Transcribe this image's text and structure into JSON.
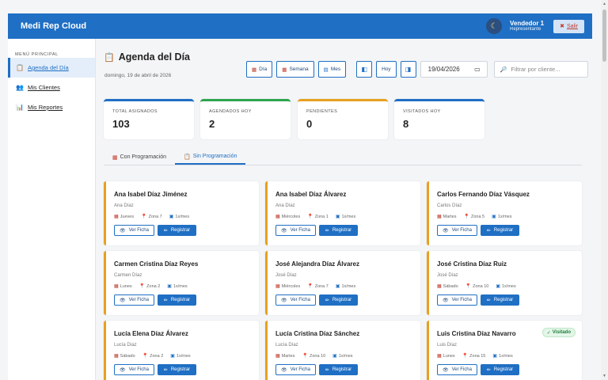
{
  "app": {
    "brand": "Medi Rep Cloud",
    "theme_icon": "moon-icon",
    "user_name": "Vendedor 1",
    "user_role": "Representante",
    "logout_label": "Salir"
  },
  "sidebar": {
    "title": "MENÚ PRINCIPAL",
    "items": [
      {
        "label": "Agenda del Día",
        "icon": "clipboard-icon"
      },
      {
        "label": "Mis Clientes",
        "icon": "users-icon"
      },
      {
        "label": "Mis Reportes",
        "icon": "chart-icon"
      }
    ]
  },
  "header": {
    "title": "Agenda del Día",
    "date_text": "domingo, 19 de abril de 2026"
  },
  "toolbar": {
    "day": "Día",
    "week": "Semana",
    "month": "Mes",
    "today": "Hoy",
    "prev_icon": "prev-icon",
    "next_icon": "next-icon",
    "date_value": "19/04/2026",
    "filter_placeholder": "Filtrar por cliente..."
  },
  "stats": [
    {
      "label": "TOTAL ASIGNADOS",
      "value": "103",
      "color": "#1f6fc4"
    },
    {
      "label": "AGENDADOS HOY",
      "value": "2",
      "color": "#2ea44f"
    },
    {
      "label": "PENDIENTES",
      "value": "0",
      "color": "#e8a01f"
    },
    {
      "label": "VISITADOS HOY",
      "value": "8",
      "color": "#1f6fc4"
    }
  ],
  "tabs": [
    {
      "label": "Con Programación",
      "active": false
    },
    {
      "label": "Sin Programación",
      "active": true
    }
  ],
  "card_labels": {
    "view": "Ver Ficha",
    "register": "Registrar",
    "visited": "Visitado"
  },
  "cards": [
    {
      "name": "Ana Isabel Díaz Jiménez",
      "sub": "Ana Díaz",
      "day": "Jueves",
      "zone": "Zona 7",
      "freq": "1x/mes"
    },
    {
      "name": "Ana Isabel Díaz Álvarez",
      "sub": "Ana Díaz",
      "day": "Miércoles",
      "zone": "Zona 1",
      "freq": "1x/mes"
    },
    {
      "name": "Carlos Fernando Díaz Vásquez",
      "sub": "Carlos Díaz",
      "day": "Martes",
      "zone": "Zona 5",
      "freq": "1x/mes"
    },
    {
      "name": "Carmen Cristina Díaz Reyes",
      "sub": "Carmen Díaz",
      "day": "Lunes",
      "zone": "Zona 2",
      "freq": "1x/mes"
    },
    {
      "name": "José Alejandra Díaz Álvarez",
      "sub": "José Díaz",
      "day": "Miércoles",
      "zone": "Zona 7",
      "freq": "1x/mes"
    },
    {
      "name": "José Cristina Díaz Ruiz",
      "sub": "José Díaz",
      "day": "Sábado",
      "zone": "Zona 10",
      "freq": "1x/mes"
    },
    {
      "name": "Lucía Elena Díaz Álvarez",
      "sub": "Lucía Díaz",
      "day": "Sábado",
      "zone": "Zona 2",
      "freq": "1x/mes"
    },
    {
      "name": "Lucía Cristina Díaz Sánchez",
      "sub": "Lucía Díaz",
      "day": "Martes",
      "zone": "Zona 10",
      "freq": "1x/mes"
    },
    {
      "name": "Luis Cristina Díaz Navarro",
      "sub": "Luis Díaz",
      "day": "Lunes",
      "zone": "Zona 15",
      "freq": "1x/mes",
      "visited": true
    }
  ]
}
